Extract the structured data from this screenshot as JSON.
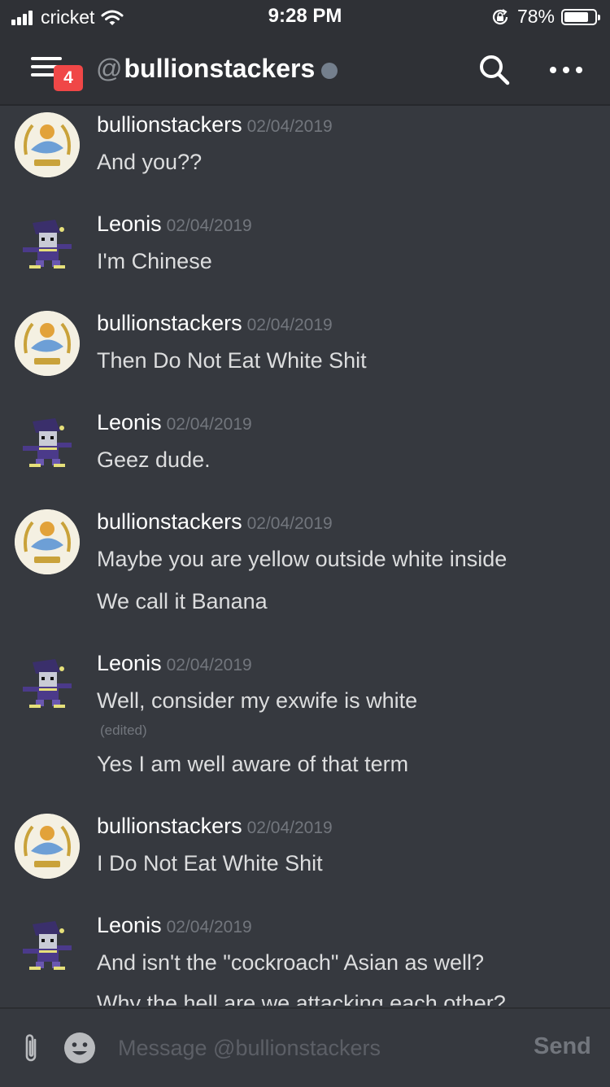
{
  "status": {
    "carrier": "cricket",
    "time": "9:28 PM",
    "battery": "78%",
    "battery_level": 0.78
  },
  "header": {
    "badge": "4",
    "at": "@",
    "channel": "bullionstackers",
    "icons": {
      "menu": "hamburger-icon",
      "search": "search-icon",
      "more": "more-icon",
      "presence": "offline-status"
    }
  },
  "messages": [
    {
      "author": "bullionstackers",
      "time": "02/04/2019",
      "lines": [
        "And you??"
      ]
    },
    {
      "author": "Leonis",
      "time": "02/04/2019",
      "lines": [
        "I'm Chinese"
      ]
    },
    {
      "author": "bullionstackers",
      "time": "02/04/2019",
      "lines": [
        "Then Do Not Eat  White Shit"
      ]
    },
    {
      "author": "Leonis",
      "time": "02/04/2019",
      "lines": [
        "Geez dude."
      ]
    },
    {
      "author": "bullionstackers",
      "time": "02/04/2019",
      "lines": [
        "Maybe you are  yellow outside white inside",
        "We call it Banana"
      ]
    },
    {
      "author": "Leonis",
      "time": "02/04/2019",
      "lines": [
        "Well, consider my exwife is white",
        "Yes I am well aware of that term"
      ],
      "edited": "(edited)"
    },
    {
      "author": "bullionstackers",
      "time": "02/04/2019",
      "lines": [
        "I Do Not Eat White Shit"
      ]
    },
    {
      "author": "Leonis",
      "time": "02/04/2019",
      "lines": [
        "And isn't the \"cockroach\" Asian as well?",
        "Why the hell are we attacking each other?"
      ]
    }
  ],
  "composer": {
    "placeholder": "Message @bullionstackers",
    "send": "Send",
    "icons": {
      "attach": "paperclip-icon",
      "emoji": "emoji-icon"
    }
  }
}
